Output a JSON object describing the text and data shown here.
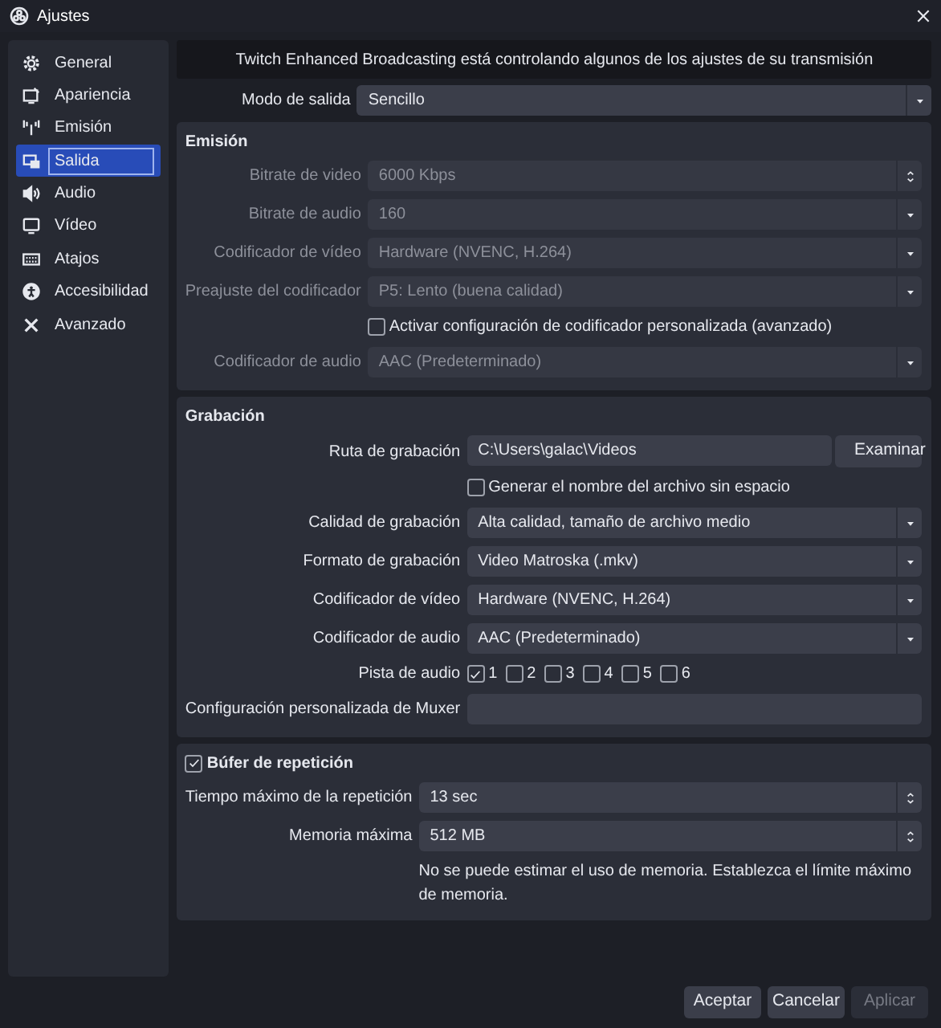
{
  "window": {
    "title": "Ajustes"
  },
  "sidebar": {
    "items": [
      {
        "label": "General",
        "selected": false
      },
      {
        "label": "Apariencia",
        "selected": false
      },
      {
        "label": "Emisión",
        "selected": false
      },
      {
        "label": "Salida",
        "selected": true
      },
      {
        "label": "Audio",
        "selected": false
      },
      {
        "label": "Vídeo",
        "selected": false
      },
      {
        "label": "Atajos",
        "selected": false
      },
      {
        "label": "Accesibilidad",
        "selected": false
      },
      {
        "label": "Avanzado",
        "selected": false
      }
    ]
  },
  "banner": "Twitch Enhanced Broadcasting está controlando algunos de los ajustes de su transmisión",
  "output_mode": {
    "label": "Modo de salida",
    "value": "Sencillo"
  },
  "sections": [
    {
      "title": "Emisión",
      "rows": [
        {
          "kind": "spin",
          "label": "Bitrate de video",
          "value": "6000 Kbps",
          "disabled": true
        },
        {
          "kind": "select",
          "label": "Bitrate de audio",
          "value": "160",
          "disabled": true
        },
        {
          "kind": "select",
          "label": "Codificador de vídeo",
          "value": "Hardware (NVENC, H.264)",
          "disabled": true
        },
        {
          "kind": "select",
          "label": "Preajuste del codificador",
          "value": "P5: Lento (buena calidad)",
          "disabled": true
        },
        {
          "kind": "check",
          "label": "Activar configuración de codificador personalizada (avanzado)",
          "checked": false,
          "disabled": false
        },
        {
          "kind": "select",
          "label": "Codificador de audio",
          "value": "AAC (Predeterminado)",
          "disabled": true
        }
      ]
    },
    {
      "title": "Grabación",
      "rows": [
        {
          "kind": "path",
          "label": "Ruta de grabación",
          "value": "C:\\Users\\galac\\Videos",
          "button": "Examinar",
          "disabled": false
        },
        {
          "kind": "check",
          "label": "Generar el nombre del archivo sin espacio",
          "checked": false,
          "disabled": false
        },
        {
          "kind": "select",
          "label": "Calidad de grabación",
          "value": "Alta calidad, tamaño de archivo medio",
          "disabled": false
        },
        {
          "kind": "select",
          "label": "Formato de grabación",
          "value": "Video Matroska (.mkv)",
          "disabled": false
        },
        {
          "kind": "select",
          "label": "Codificador de vídeo",
          "value": "Hardware (NVENC, H.264)",
          "disabled": false
        },
        {
          "kind": "select",
          "label": "Codificador de audio",
          "value": "AAC (Predeterminado)",
          "disabled": false
        },
        {
          "kind": "tracks",
          "label": "Pista de audio",
          "tracks": [
            {
              "label": "1",
              "checked": true
            },
            {
              "label": "2",
              "checked": false
            },
            {
              "label": "3",
              "checked": false
            },
            {
              "label": "4",
              "checked": false
            },
            {
              "label": "5",
              "checked": false
            },
            {
              "label": "6",
              "checked": false
            }
          ]
        },
        {
          "kind": "text",
          "label": "Configuración personalizada de Muxer"
        }
      ]
    },
    {
      "title": "Búfer de repetición",
      "checked": true,
      "rows": [
        {
          "kind": "spin",
          "label": "Tiempo máximo de la repetición",
          "value": "13 sec",
          "disabled": false
        },
        {
          "kind": "spin",
          "label": "Memoria máxima",
          "value": "512 MB",
          "disabled": false
        },
        {
          "kind": "note",
          "text": "No se puede estimar el uso de memoria. Establezca el límite máximo de memoria."
        }
      ]
    }
  ],
  "buttons": [
    {
      "label": "Aceptar",
      "disabled": false
    },
    {
      "label": "Cancelar",
      "disabled": false
    },
    {
      "label": "Aplicar",
      "disabled": true
    }
  ]
}
